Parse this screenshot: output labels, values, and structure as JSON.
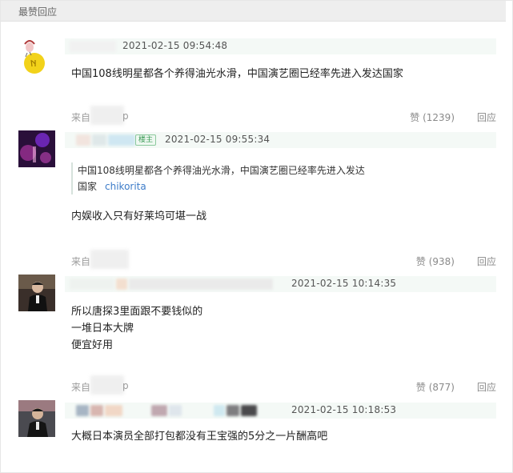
{
  "section": {
    "title": "最赞回应"
  },
  "comments": [
    {
      "timestamp": "2021-02-15 09:54:48",
      "text": "中国108线明星都各个养得油光水滑，中国演艺圈已经率先进入发达国家",
      "source_prefix": "来自",
      "source_suffix": "p",
      "likes": "赞 (1239)",
      "reply": "回应"
    },
    {
      "op_badge": "楼主",
      "timestamp": "2021-02-15 09:55:34",
      "quote_line1": "中国108线明星都各个养得油光水滑，中国演艺圈已经率先进入发达",
      "quote_line2": "国家",
      "quote_author": "chikorita",
      "text": "内娱收入只有好莱坞可堪一战",
      "source_prefix": "来自",
      "likes": "赞 (938)",
      "reply": "回应"
    },
    {
      "timestamp": "2021-02-15 10:14:35",
      "text_lines": [
        "所以唐探3里面跟不要钱似的",
        "一堆日本大牌",
        "便宜好用"
      ],
      "source_prefix": "来自",
      "source_suffix": "p",
      "likes": "赞 (877)",
      "reply": "回应"
    },
    {
      "timestamp": "2021-02-15 10:18:53",
      "text": "大概日本演员全部打包都没有王宝强的5分之一片酬高吧"
    }
  ]
}
